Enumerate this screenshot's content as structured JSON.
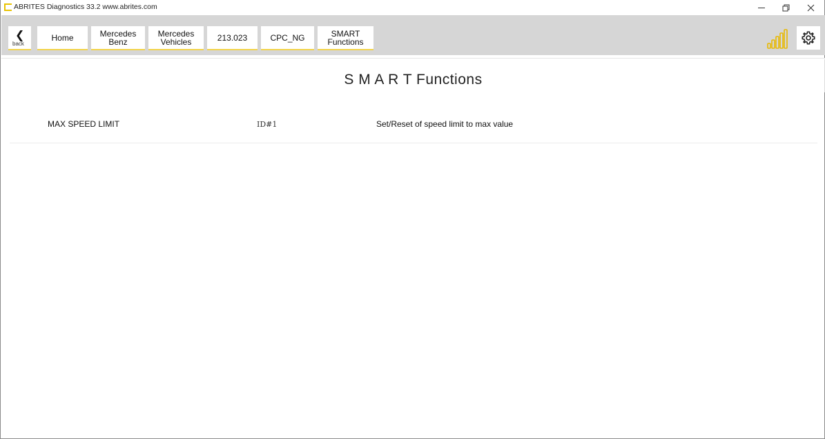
{
  "window": {
    "title": "ABRITES Diagnostics 33.2  www.abrites.com",
    "minimize_glyph": "–",
    "maximize_glyph": "❐",
    "close_glyph": "✕"
  },
  "toolbar": {
    "back_glyph": "❮",
    "back_label": "back",
    "breadcrumbs": [
      {
        "label": "Home"
      },
      {
        "label": "Mercedes\nBenz"
      },
      {
        "label": "Mercedes\nVehicles"
      },
      {
        "label": "213.023"
      },
      {
        "label": "CPC_NG"
      },
      {
        "label": "SMART\nFunctions"
      }
    ],
    "signal_icon": "signal-strength-icon",
    "settings_icon": "gear-icon",
    "accent_color": "#f2d34a",
    "signal_color": "#e8b800"
  },
  "page": {
    "title": "S M A R T  Functions"
  },
  "functions": [
    {
      "name": "MAX SPEED LIMIT",
      "id": "ID#1",
      "description": "Set/Reset of speed limit to max value"
    }
  ]
}
